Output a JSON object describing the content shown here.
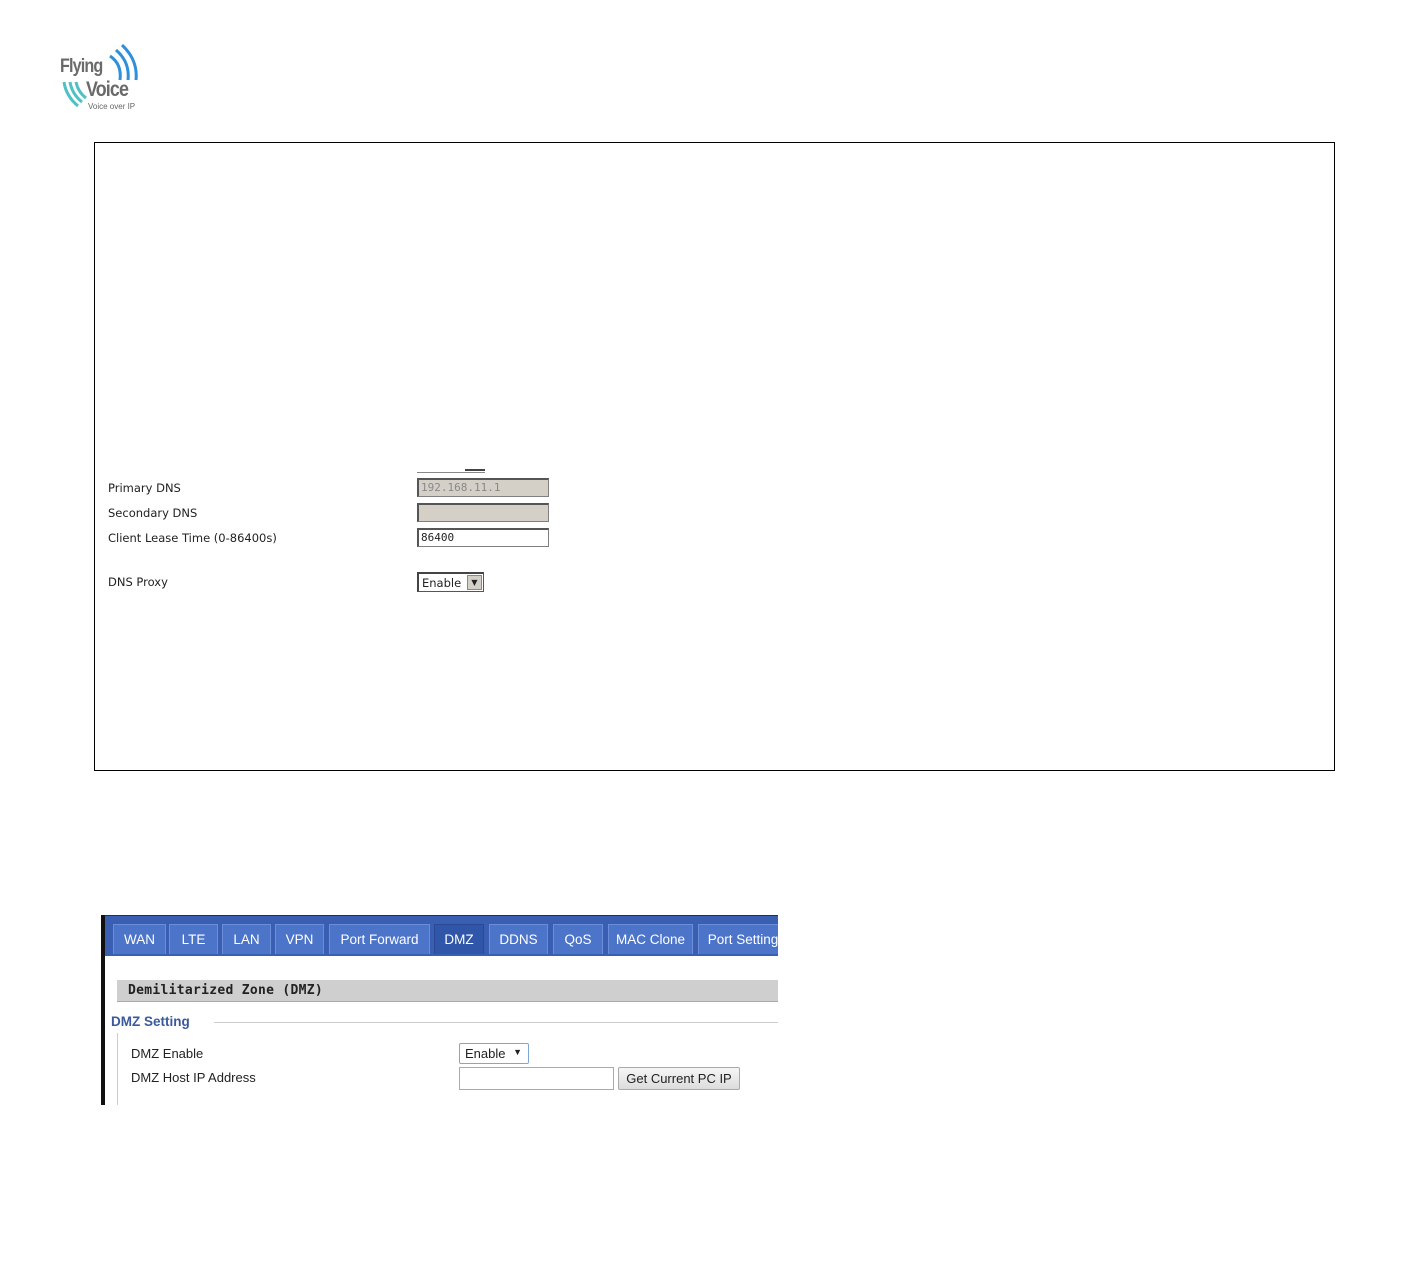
{
  "logo": {
    "line1": "Flying",
    "line2": "Voice",
    "tagline": "Voice over IP"
  },
  "lan_screenshot": {
    "fields": [
      {
        "label": "Primary DNS",
        "value": "192.168.11.1",
        "disabled": true
      },
      {
        "label": "Secondary DNS",
        "value": "",
        "disabled": true
      },
      {
        "label": "Client Lease Time (0-86400s)",
        "value": "86400",
        "disabled": false
      }
    ],
    "dns_proxy": {
      "label": "DNS Proxy",
      "selected": "Enable"
    }
  },
  "dmz_screenshot": {
    "tabs": [
      {
        "label": "WAN",
        "active": false
      },
      {
        "label": "LTE",
        "active": false
      },
      {
        "label": "LAN",
        "active": false
      },
      {
        "label": "VPN",
        "active": false
      },
      {
        "label": "Port Forward",
        "active": false
      },
      {
        "label": "DMZ",
        "active": true
      },
      {
        "label": "DDNS",
        "active": false
      },
      {
        "label": "QoS",
        "active": false
      },
      {
        "label": "MAC Clone",
        "active": false
      },
      {
        "label": "Port Setting",
        "active": false
      }
    ],
    "section_title": "Demilitarized Zone (DMZ)",
    "legend": "DMZ Setting",
    "dmz_enable": {
      "label": "DMZ Enable",
      "selected": "Enable"
    },
    "dmz_host": {
      "label": "DMZ Host IP Address",
      "value": "",
      "button": "Get Current PC IP"
    }
  }
}
